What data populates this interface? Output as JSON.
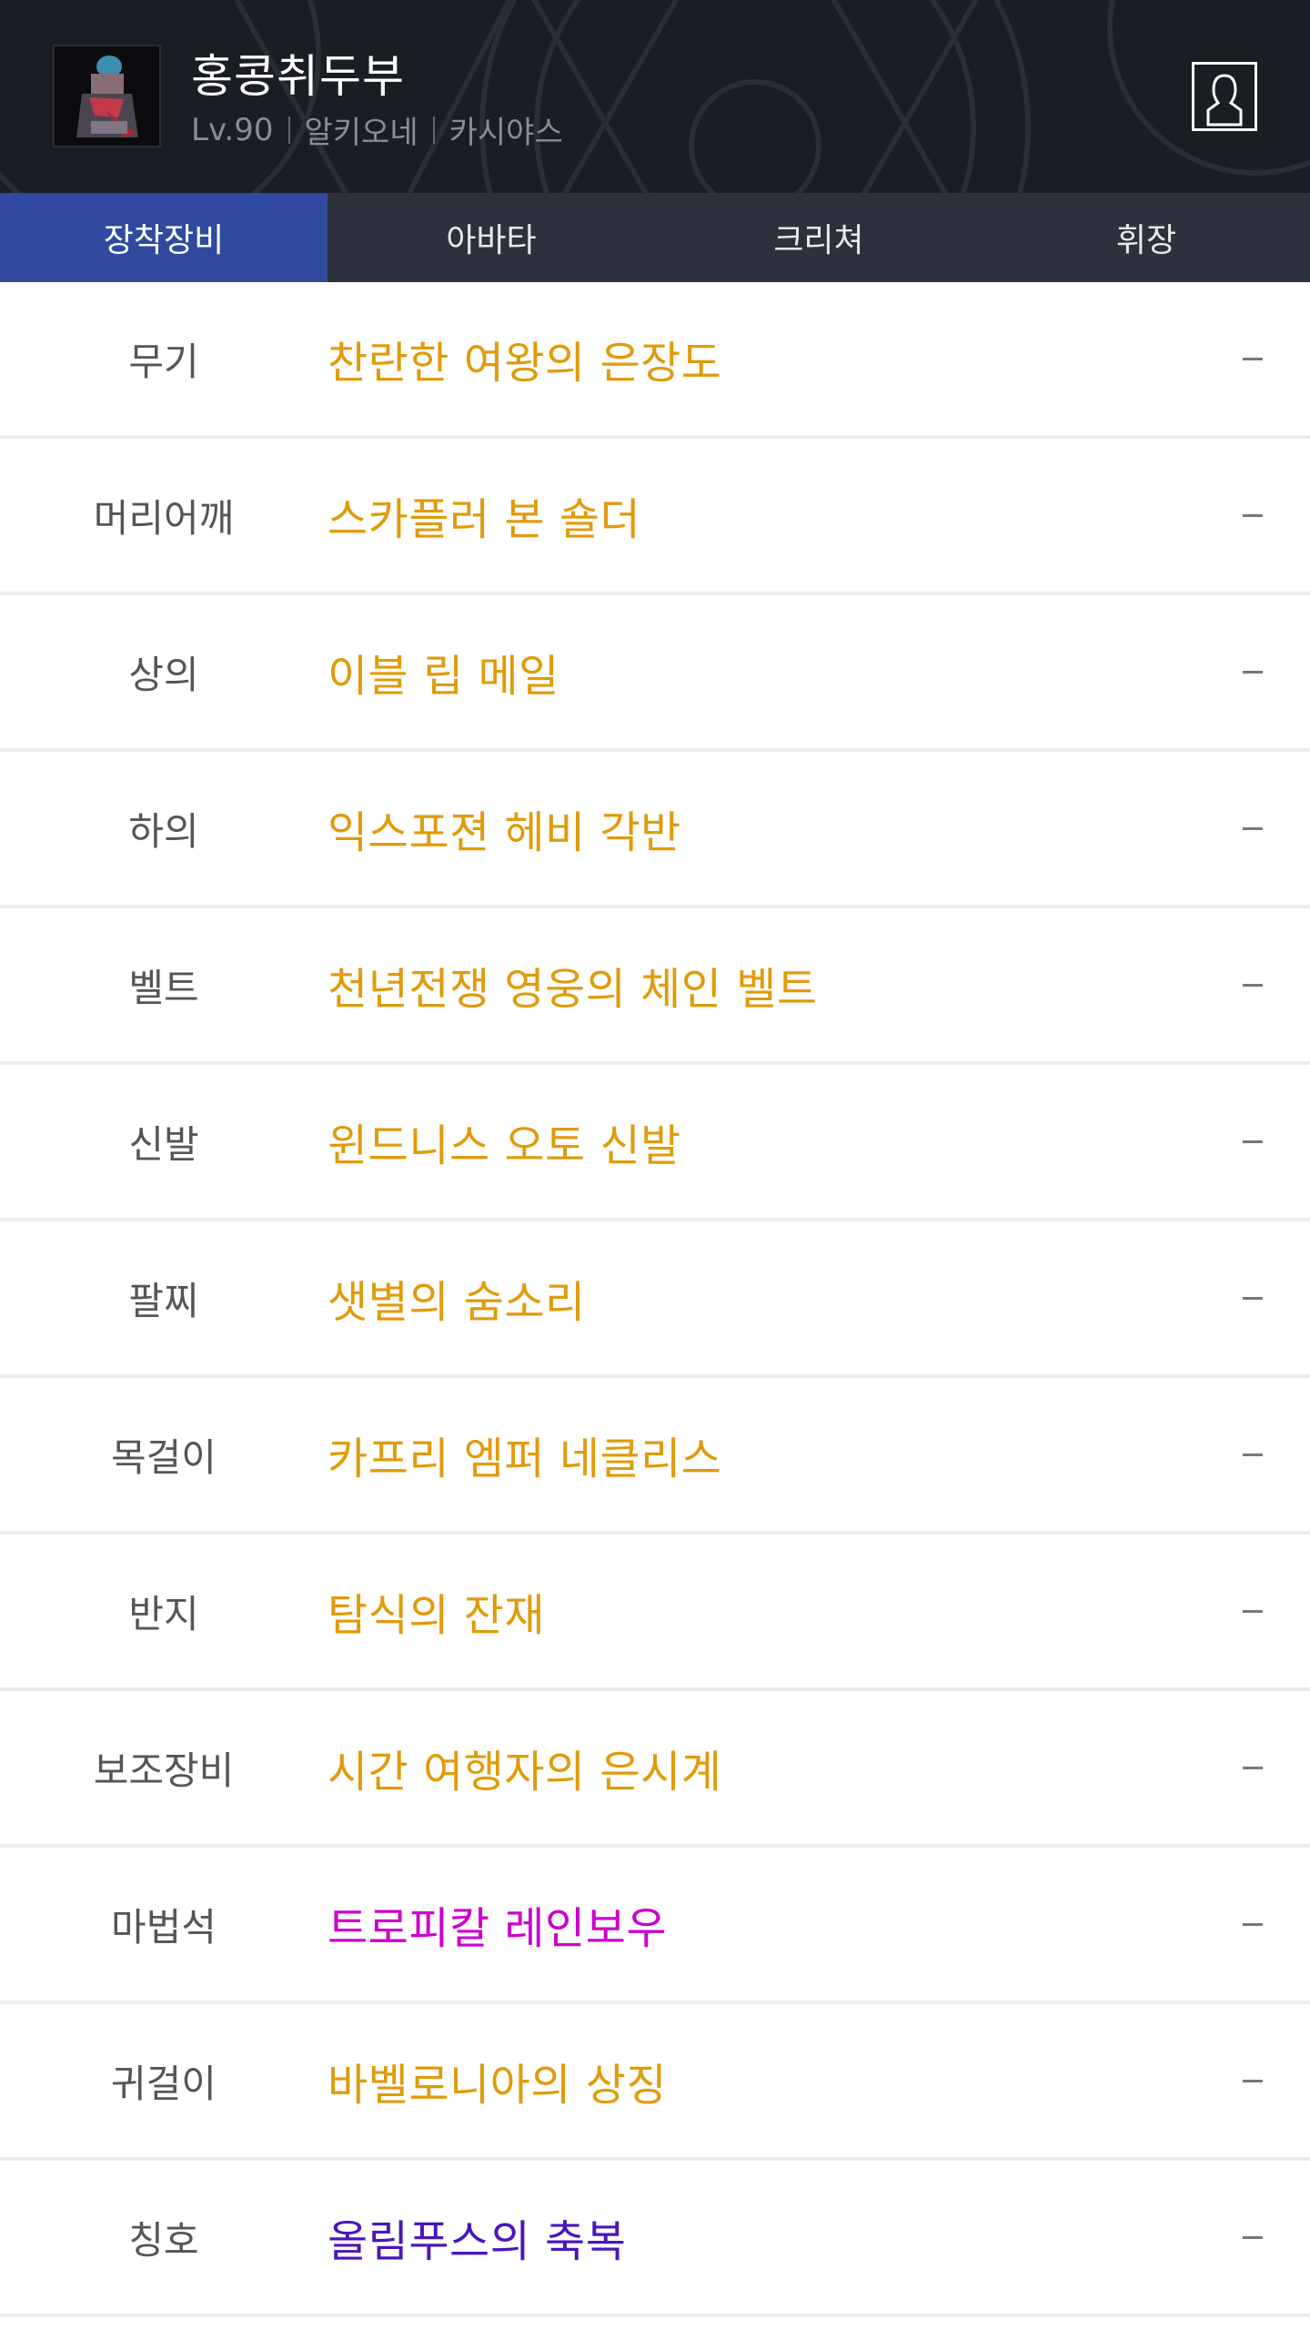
{
  "header": {
    "character_name": "홍콩취두부",
    "level": "Lv.90",
    "job": "알키오네",
    "server": "카시야스",
    "profile_icon": "user-profile-icon",
    "background_color": "#1b1d24"
  },
  "tabs": [
    {
      "label": "장착장비",
      "active": true
    },
    {
      "label": "아바타",
      "active": false
    },
    {
      "label": "크리쳐",
      "active": false
    },
    {
      "label": "휘장",
      "active": false
    }
  ],
  "colors": {
    "tab_active": "#2f4a9e",
    "tab_bar": "#2d313c",
    "unique_item": "#e09b0b",
    "epic_item": "#cc00cc",
    "legendary_item": "#4b16b8",
    "slot_label": "#555555"
  },
  "equipment": [
    {
      "slot": "무기",
      "item": "찬란한 여왕의 은장도",
      "color": "#e09b0b",
      "value": "–"
    },
    {
      "slot": "머리어깨",
      "item": "스카플러 본 숄더",
      "color": "#e09b0b",
      "value": "–"
    },
    {
      "slot": "상의",
      "item": "이블 립 메일",
      "color": "#e09b0b",
      "value": "–"
    },
    {
      "slot": "하의",
      "item": "익스포젼 헤비 각반",
      "color": "#e09b0b",
      "value": "–"
    },
    {
      "slot": "벨트",
      "item": "천년전쟁 영웅의 체인 벨트",
      "color": "#e09b0b",
      "value": "–"
    },
    {
      "slot": "신발",
      "item": "윈드니스 오토 신발",
      "color": "#e09b0b",
      "value": "–"
    },
    {
      "slot": "팔찌",
      "item": "샛별의 숨소리",
      "color": "#e09b0b",
      "value": "–"
    },
    {
      "slot": "목걸이",
      "item": "카프리 엠퍼 네클리스",
      "color": "#e09b0b",
      "value": "–"
    },
    {
      "slot": "반지",
      "item": "탐식의 잔재",
      "color": "#e09b0b",
      "value": "–"
    },
    {
      "slot": "보조장비",
      "item": "시간 여행자의 은시계",
      "color": "#e09b0b",
      "value": "–"
    },
    {
      "slot": "마법석",
      "item": "트로피칼 레인보우",
      "color": "#cc00cc",
      "value": "–"
    },
    {
      "slot": "귀걸이",
      "item": "바벨로니아의 상징",
      "color": "#e09b0b",
      "value": "–"
    },
    {
      "slot": "칭호",
      "item": "올림푸스의 축복",
      "color": "#4b16b8",
      "value": "–"
    }
  ]
}
